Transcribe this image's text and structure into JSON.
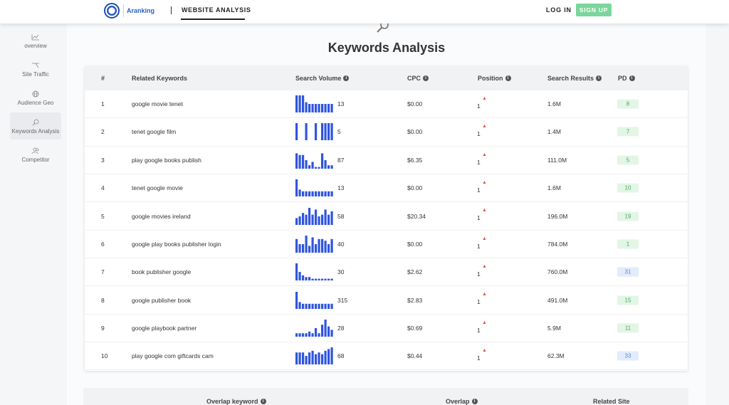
{
  "header": {
    "logo_text": "Aranking",
    "nav_tab": "WEBSITE ANALYSIS",
    "login": "LOG IN",
    "signup": "SIGN UP",
    "colors": {
      "brand": "#2a5fc4",
      "signup": "#7bd69b"
    }
  },
  "sidebar": {
    "items": [
      {
        "label": "overview",
        "icon": "line-chart-icon"
      },
      {
        "label": "Site Traffic",
        "icon": "branch-icon"
      },
      {
        "label": "Audience Geo",
        "icon": "globe-icon"
      },
      {
        "label": "Keywords Analysis",
        "icon": "search-icon",
        "active": true
      },
      {
        "label": "Competitor",
        "icon": "users-icon"
      }
    ]
  },
  "main": {
    "title": "Keywords Analysis",
    "table": {
      "headers": {
        "num": "#",
        "keyword": "Related Keywords",
        "volume": "Search Volume",
        "cpc": "CPC",
        "position": "Position",
        "results": "Search Results",
        "pd": "PD"
      },
      "rows": [
        {
          "num": "1",
          "keyword": "google movie tenet",
          "volume": "13",
          "cpc": "$0.00",
          "position": "1",
          "results": "1.6M",
          "pd": "8",
          "pd_color": "green",
          "trend": [
            10,
            10,
            10,
            6,
            5,
            5,
            5,
            5,
            5,
            5,
            5,
            5
          ]
        },
        {
          "num": "2",
          "keyword": "tenet google film",
          "volume": "5",
          "cpc": "$0.00",
          "position": "1",
          "results": "1.4M",
          "pd": "7",
          "pd_color": "green",
          "trend": [
            10,
            0,
            0,
            10,
            0,
            0,
            10,
            0,
            10,
            10,
            10,
            10
          ]
        },
        {
          "num": "3",
          "keyword": "play google books publish",
          "volume": "87",
          "cpc": "$6.35",
          "position": "1",
          "results": "111.0M",
          "pd": "5",
          "pd_color": "green",
          "trend": [
            9,
            8,
            8,
            5,
            2,
            4,
            1,
            1,
            9,
            5,
            2,
            2
          ]
        },
        {
          "num": "4",
          "keyword": "tenet google movie",
          "volume": "13",
          "cpc": "$0.00",
          "position": "1",
          "results": "1.6M",
          "pd": "10",
          "pd_color": "green",
          "trend": [
            10,
            4,
            3,
            3,
            3,
            3,
            3,
            3,
            3,
            3,
            3,
            3
          ]
        },
        {
          "num": "5",
          "keyword": "google movies ireland",
          "volume": "58",
          "cpc": "$20.34",
          "position": "1",
          "results": "196.0M",
          "pd": "19",
          "pd_color": "green",
          "trend": [
            4,
            5,
            7,
            6,
            10,
            6,
            9,
            5,
            6,
            9,
            6,
            8
          ]
        },
        {
          "num": "6",
          "keyword": "google play books publisher login",
          "volume": "40",
          "cpc": "$0.00",
          "position": "1",
          "results": "784.0M",
          "pd": "1",
          "pd_color": "green",
          "trend": [
            8,
            5,
            5,
            10,
            4,
            9,
            5,
            8,
            8,
            7,
            5,
            8
          ]
        },
        {
          "num": "7",
          "keyword": "book publisher google",
          "volume": "30",
          "cpc": "$2.62",
          "position": "1",
          "results": "760.0M",
          "pd": "31",
          "pd_color": "blue",
          "trend": [
            10,
            5,
            3,
            2,
            2,
            1,
            1,
            1,
            1,
            1,
            1,
            1
          ]
        },
        {
          "num": "8",
          "keyword": "google publisher book",
          "volume": "315",
          "cpc": "$2.83",
          "position": "1",
          "results": "491.0M",
          "pd": "15",
          "pd_color": "green",
          "trend": [
            10,
            4,
            3,
            3,
            3,
            3,
            3,
            3,
            3,
            3,
            3,
            3
          ]
        },
        {
          "num": "9",
          "keyword": "google playbook partner",
          "volume": "28",
          "cpc": "$0.69",
          "position": "1",
          "results": "5.9M",
          "pd": "11",
          "pd_color": "green",
          "trend": [
            2,
            2,
            2,
            2,
            3,
            2,
            5,
            2,
            7,
            10,
            6,
            4
          ]
        },
        {
          "num": "10",
          "keyword": "play google com giftcards cam",
          "volume": "68",
          "cpc": "$0.44",
          "position": "1",
          "results": "62.3M",
          "pd": "33",
          "pd_color": "blue",
          "trend": [
            7,
            7,
            7,
            5,
            7,
            8,
            6,
            7,
            6,
            8,
            9,
            10
          ]
        }
      ]
    },
    "overlap_table": {
      "headers": {
        "keyword": "Overlap keyword",
        "overlap": "Overlap",
        "site": "Related Site"
      }
    },
    "colors": {
      "bar": "#2f55e0",
      "pd_green_bg": "#e3f6e6",
      "pd_green_text": "#47a862",
      "pd_blue_bg": "#e2ecfb",
      "pd_blue_text": "#5a8ad8",
      "thumb": "#e4564a"
    }
  }
}
